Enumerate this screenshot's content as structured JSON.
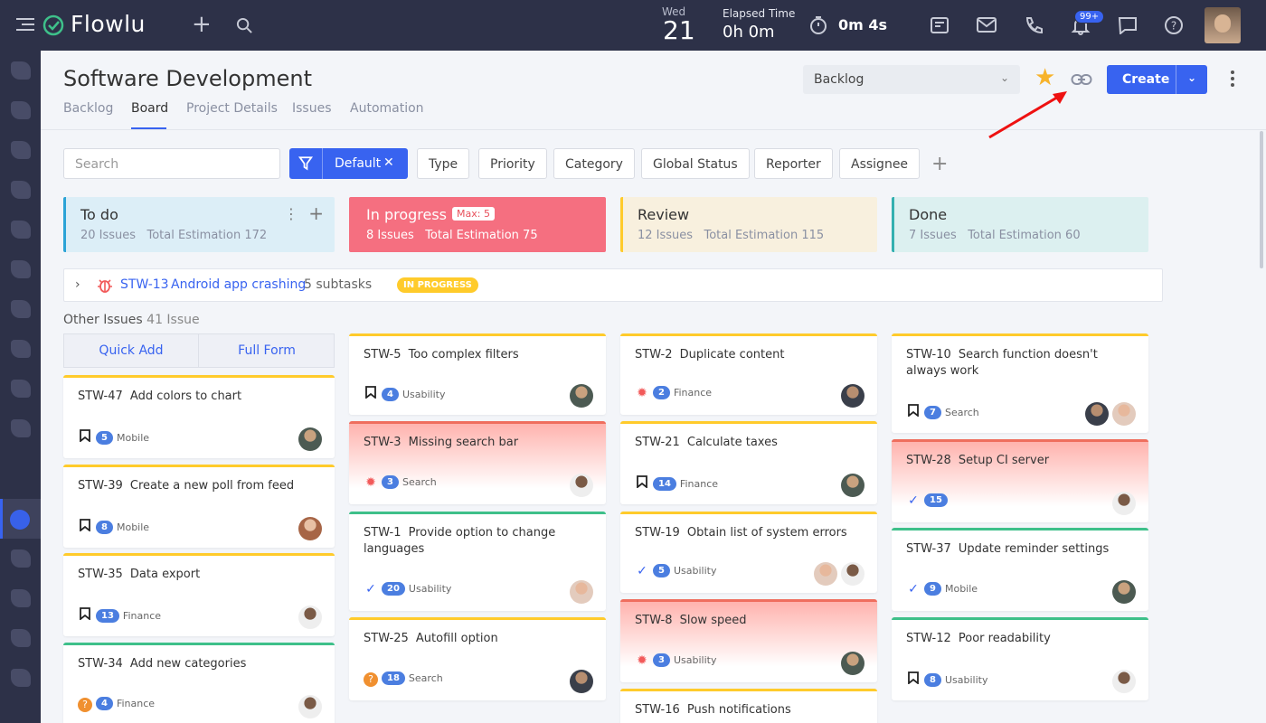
{
  "app": {
    "name": "Flowlu"
  },
  "topbar": {
    "date_day": "Wed",
    "date_num": "21",
    "elapsed_label": "Elapsed Time",
    "elapsed_value": "0h 0m",
    "timer_value": "0m 4s",
    "notifications_badge": "99+"
  },
  "page": {
    "title": "Software Development",
    "tabs": [
      {
        "label": "Backlog",
        "active": false
      },
      {
        "label": "Board",
        "active": true
      },
      {
        "label": "Project Details",
        "active": false
      },
      {
        "label": "Issues",
        "active": false
      },
      {
        "label": "Automation",
        "active": false
      }
    ],
    "board_select": "Backlog",
    "create_label": "Create"
  },
  "filters": {
    "search_placeholder": "Search",
    "active_filter": "Default",
    "chips": [
      "Type",
      "Priority",
      "Category",
      "Global Status",
      "Reporter",
      "Assignee"
    ]
  },
  "columns": [
    {
      "name": "To do",
      "issues": "20 Issues",
      "estimation": "Total Estimation 172",
      "bg": "#dceef7",
      "accent": "#2ba3d6",
      "text": "#333"
    },
    {
      "name": "In progress",
      "max": "Max: 5",
      "issues": "8 Issues",
      "estimation": "Total Estimation 75",
      "bg": "#f56f80",
      "accent": "#f56f80",
      "text": "#fff"
    },
    {
      "name": "Review",
      "issues": "12 Issues",
      "estimation": "Total Estimation 115",
      "bg": "#f8f0de",
      "accent": "#ffcb2b",
      "text": "#333"
    },
    {
      "name": "Done",
      "issues": "7 Issues",
      "estimation": "Total Estimation 60",
      "bg": "#dcf0f0",
      "accent": "#34b0b0",
      "text": "#333"
    }
  ],
  "swimlane": {
    "key": "STW-13",
    "title": "Android app crashing",
    "subtasks": "5 subtasks",
    "status": "IN PROGRESS"
  },
  "other": {
    "label": "Other Issues",
    "count": "41 Issue",
    "quick_add": "Quick Add",
    "full_form": "Full Form"
  },
  "cards": {
    "todo": [
      {
        "key": "STW-47",
        "title": "Add colors to chart",
        "type": "book",
        "points": "5",
        "category": "Mobile"
      },
      {
        "key": "STW-39",
        "title": "Create a new poll from feed",
        "type": "book",
        "points": "8",
        "category": "Mobile"
      },
      {
        "key": "STW-35",
        "title": "Data export",
        "type": "book",
        "points": "13",
        "category": "Finance"
      },
      {
        "key": "STW-34",
        "title": "Add new categories",
        "type": "question",
        "points": "4",
        "category": "Finance"
      }
    ],
    "progress": [
      {
        "key": "STW-5",
        "title": "Too complex filters",
        "type": "book",
        "points": "4",
        "category": "Usability"
      },
      {
        "key": "STW-3",
        "title": "Missing search bar",
        "type": "bug",
        "points": "3",
        "category": "Search"
      },
      {
        "key": "STW-1",
        "title": "Provide option to change languages",
        "type": "check",
        "points": "20",
        "category": "Usability"
      },
      {
        "key": "STW-25",
        "title": "Autofill option",
        "type": "question",
        "points": "18",
        "category": "Search"
      }
    ],
    "review": [
      {
        "key": "STW-2",
        "title": "Duplicate content",
        "type": "bug",
        "points": "2",
        "category": "Finance"
      },
      {
        "key": "STW-21",
        "title": "Calculate taxes",
        "type": "book",
        "points": "14",
        "category": "Finance"
      },
      {
        "key": "STW-19",
        "title": "Obtain list of system errors",
        "type": "check",
        "points": "5",
        "category": "Usability"
      },
      {
        "key": "STW-8",
        "title": "Slow speed",
        "type": "bug",
        "points": "3",
        "category": "Usability"
      },
      {
        "key": "STW-16",
        "title": "Push notifications"
      }
    ],
    "done": [
      {
        "key": "STW-10",
        "title": "Search function doesn't always work",
        "type": "book",
        "points": "7",
        "category": "Search"
      },
      {
        "key": "STW-28",
        "title": "Setup CI server",
        "type": "check",
        "points": "15",
        "category": ""
      },
      {
        "key": "STW-37",
        "title": "Update reminder settings",
        "type": "check",
        "points": "9",
        "category": "Mobile"
      },
      {
        "key": "STW-12",
        "title": "Poor readability",
        "type": "book",
        "points": "8",
        "category": "Usability"
      }
    ]
  }
}
